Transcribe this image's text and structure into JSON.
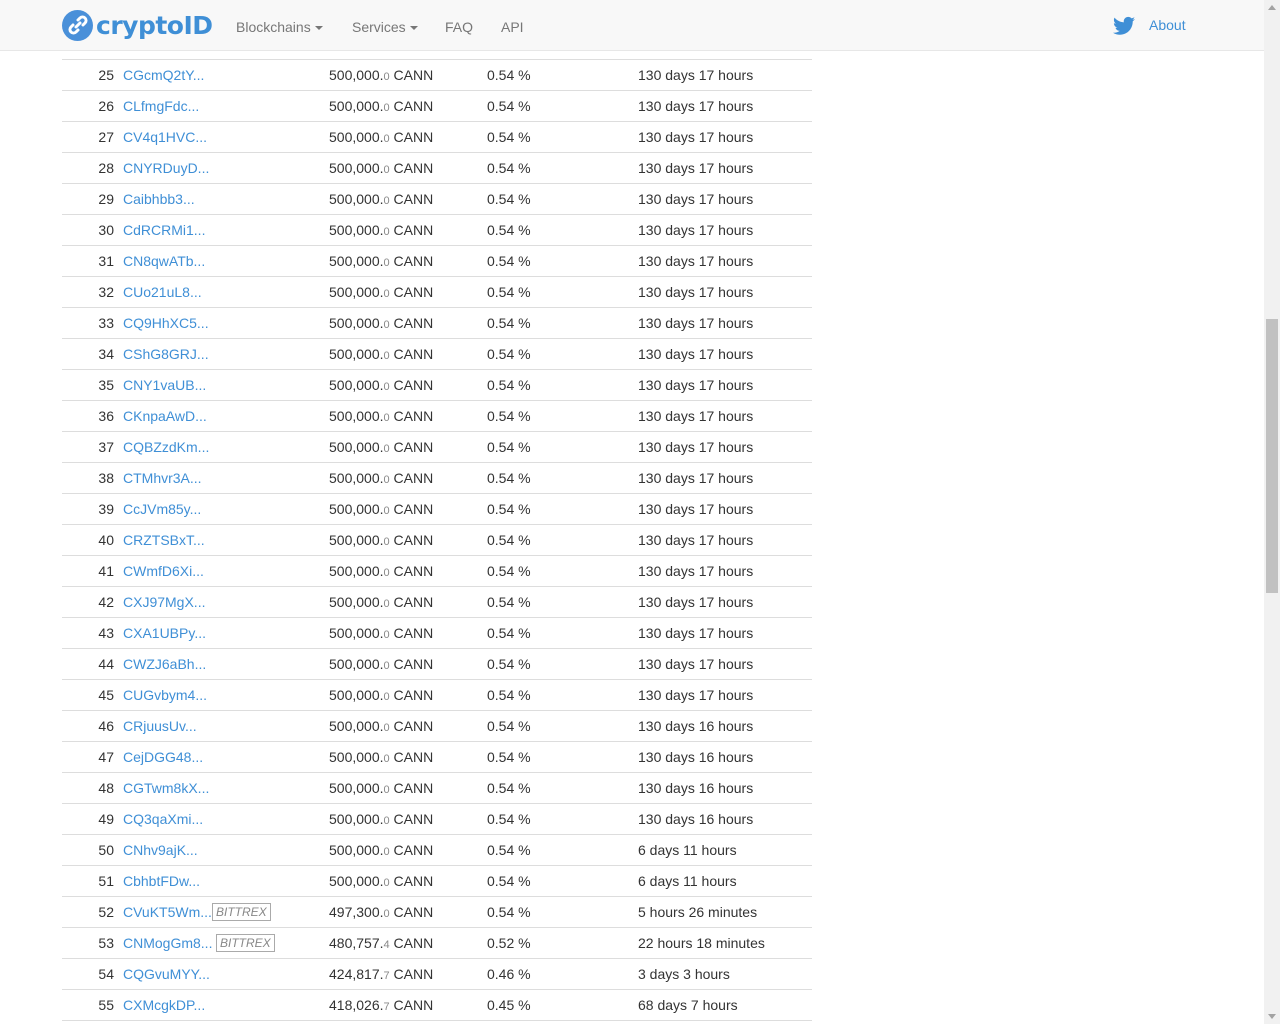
{
  "nav": {
    "logo_text": "cryptoID",
    "items": [
      {
        "label": "Blockchains",
        "dropdown": true
      },
      {
        "label": "Services",
        "dropdown": true
      },
      {
        "label": "FAQ",
        "dropdown": false
      },
      {
        "label": "API",
        "dropdown": false
      }
    ],
    "twitter_icon": "twitter-icon",
    "about": "About"
  },
  "colors": {
    "link": "#3f8fd6",
    "text": "#333333",
    "navbar_bg": "#f8f8f8",
    "border": "#dddddd"
  },
  "table": {
    "unit": "CANN",
    "rows": [
      {
        "rank": "25",
        "address": "CGcmQ2tY...",
        "tag": "",
        "amount_int": "500,000.",
        "amount_dec": "0",
        "percent": "0.54 %",
        "age": "130 days 17 hours"
      },
      {
        "rank": "26",
        "address": "CLfmgFdc...",
        "tag": "",
        "amount_int": "500,000.",
        "amount_dec": "0",
        "percent": "0.54 %",
        "age": "130 days 17 hours"
      },
      {
        "rank": "27",
        "address": "CV4q1HVC...",
        "tag": "",
        "amount_int": "500,000.",
        "amount_dec": "0",
        "percent": "0.54 %",
        "age": "130 days 17 hours"
      },
      {
        "rank": "28",
        "address": "CNYRDuyD...",
        "tag": "",
        "amount_int": "500,000.",
        "amount_dec": "0",
        "percent": "0.54 %",
        "age": "130 days 17 hours"
      },
      {
        "rank": "29",
        "address": "Caibhbb3...",
        "tag": "",
        "amount_int": "500,000.",
        "amount_dec": "0",
        "percent": "0.54 %",
        "age": "130 days 17 hours"
      },
      {
        "rank": "30",
        "address": "CdRCRMi1...",
        "tag": "",
        "amount_int": "500,000.",
        "amount_dec": "0",
        "percent": "0.54 %",
        "age": "130 days 17 hours"
      },
      {
        "rank": "31",
        "address": "CN8qwATb...",
        "tag": "",
        "amount_int": "500,000.",
        "amount_dec": "0",
        "percent": "0.54 %",
        "age": "130 days 17 hours"
      },
      {
        "rank": "32",
        "address": "CUo21uL8...",
        "tag": "",
        "amount_int": "500,000.",
        "amount_dec": "0",
        "percent": "0.54 %",
        "age": "130 days 17 hours"
      },
      {
        "rank": "33",
        "address": "CQ9HhXC5...",
        "tag": "",
        "amount_int": "500,000.",
        "amount_dec": "0",
        "percent": "0.54 %",
        "age": "130 days 17 hours"
      },
      {
        "rank": "34",
        "address": "CShG8GRJ...",
        "tag": "",
        "amount_int": "500,000.",
        "amount_dec": "0",
        "percent": "0.54 %",
        "age": "130 days 17 hours"
      },
      {
        "rank": "35",
        "address": "CNY1vaUB...",
        "tag": "",
        "amount_int": "500,000.",
        "amount_dec": "0",
        "percent": "0.54 %",
        "age": "130 days 17 hours"
      },
      {
        "rank": "36",
        "address": "CKnpaAwD...",
        "tag": "",
        "amount_int": "500,000.",
        "amount_dec": "0",
        "percent": "0.54 %",
        "age": "130 days 17 hours"
      },
      {
        "rank": "37",
        "address": "CQBZzdKm...",
        "tag": "",
        "amount_int": "500,000.",
        "amount_dec": "0",
        "percent": "0.54 %",
        "age": "130 days 17 hours"
      },
      {
        "rank": "38",
        "address": "CTMhvr3A...",
        "tag": "",
        "amount_int": "500,000.",
        "amount_dec": "0",
        "percent": "0.54 %",
        "age": "130 days 17 hours"
      },
      {
        "rank": "39",
        "address": "CcJVm85y...",
        "tag": "",
        "amount_int": "500,000.",
        "amount_dec": "0",
        "percent": "0.54 %",
        "age": "130 days 17 hours"
      },
      {
        "rank": "40",
        "address": "CRZTSBxT...",
        "tag": "",
        "amount_int": "500,000.",
        "amount_dec": "0",
        "percent": "0.54 %",
        "age": "130 days 17 hours"
      },
      {
        "rank": "41",
        "address": "CWmfD6Xi...",
        "tag": "",
        "amount_int": "500,000.",
        "amount_dec": "0",
        "percent": "0.54 %",
        "age": "130 days 17 hours"
      },
      {
        "rank": "42",
        "address": "CXJ97MgX...",
        "tag": "",
        "amount_int": "500,000.",
        "amount_dec": "0",
        "percent": "0.54 %",
        "age": "130 days 17 hours"
      },
      {
        "rank": "43",
        "address": "CXA1UBPy...",
        "tag": "",
        "amount_int": "500,000.",
        "amount_dec": "0",
        "percent": "0.54 %",
        "age": "130 days 17 hours"
      },
      {
        "rank": "44",
        "address": "CWZJ6aBh...",
        "tag": "",
        "amount_int": "500,000.",
        "amount_dec": "0",
        "percent": "0.54 %",
        "age": "130 days 17 hours"
      },
      {
        "rank": "45",
        "address": "CUGvbym4...",
        "tag": "",
        "amount_int": "500,000.",
        "amount_dec": "0",
        "percent": "0.54 %",
        "age": "130 days 17 hours"
      },
      {
        "rank": "46",
        "address": "CRjuusUv...",
        "tag": "",
        "amount_int": "500,000.",
        "amount_dec": "0",
        "percent": "0.54 %",
        "age": "130 days 16 hours"
      },
      {
        "rank": "47",
        "address": "CejDGG48...",
        "tag": "",
        "amount_int": "500,000.",
        "amount_dec": "0",
        "percent": "0.54 %",
        "age": "130 days 16 hours"
      },
      {
        "rank": "48",
        "address": "CGTwm8kX...",
        "tag": "",
        "amount_int": "500,000.",
        "amount_dec": "0",
        "percent": "0.54 %",
        "age": "130 days 16 hours"
      },
      {
        "rank": "49",
        "address": "CQ3qaXmi...",
        "tag": "",
        "amount_int": "500,000.",
        "amount_dec": "0",
        "percent": "0.54 %",
        "age": "130 days 16 hours"
      },
      {
        "rank": "50",
        "address": "CNhv9ajK...",
        "tag": "",
        "amount_int": "500,000.",
        "amount_dec": "0",
        "percent": "0.54 %",
        "age": "6 days 11 hours"
      },
      {
        "rank": "51",
        "address": "CbhbtFDw...",
        "tag": "",
        "amount_int": "500,000.",
        "amount_dec": "0",
        "percent": "0.54 %",
        "age": "6 days 11 hours"
      },
      {
        "rank": "52",
        "address": "CVuKT5Wm...",
        "tag": "BITTREX",
        "amount_int": "497,300.",
        "amount_dec": "0",
        "percent": "0.54 %",
        "age": "5 hours 26 minutes"
      },
      {
        "rank": "53",
        "address": "CNMogGm8...",
        "tag": "BITTREX",
        "amount_int": "480,757.",
        "amount_dec": "4",
        "percent": "0.52 %",
        "age": "22 hours 18 minutes"
      },
      {
        "rank": "54",
        "address": "CQGvuMYY...",
        "tag": "",
        "amount_int": "424,817.",
        "amount_dec": "7",
        "percent": "0.46 %",
        "age": "3 days 3 hours"
      },
      {
        "rank": "55",
        "address": "CXMcgkDP...",
        "tag": "",
        "amount_int": "418,026.",
        "amount_dec": "7",
        "percent": "0.45 %",
        "age": "68 days 7 hours"
      }
    ]
  },
  "scrollbar": {
    "position_fraction": 0.31
  }
}
